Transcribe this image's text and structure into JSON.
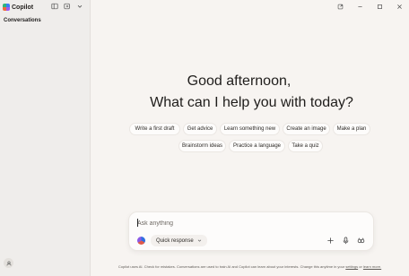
{
  "app": {
    "name": "Copilot"
  },
  "sidebar": {
    "section_title": "Conversations"
  },
  "greeting": {
    "line1": "Good afternoon,",
    "line2": "What can I help you with today?"
  },
  "suggestions": {
    "row1": [
      "Write a first draft",
      "Get advice",
      "Learn something new",
      "Create an image",
      "Make a plan"
    ],
    "row2": [
      "Brainstorm ideas",
      "Practice a language",
      "Take a quiz"
    ]
  },
  "composer": {
    "placeholder": "Ask anything",
    "mode_label": "Quick response"
  },
  "footer": {
    "text": "Copilot uses AI. Check for mistakes. Conversations are used to train AI and Copilot can learn about your interests. Change this anytime in your",
    "settings_link": "settings",
    "or": "or",
    "learn_more_link": "learn more."
  },
  "colors": {
    "background": "#f7f4f1",
    "sidebar": "#efedeb",
    "chip": "#fdfcfb"
  },
  "icons": [
    "copilot-logo-icon",
    "sidebar-toggle-icon",
    "new-chat-icon",
    "chevron-down-icon",
    "open-window-icon",
    "minimize-icon",
    "maximize-icon",
    "close-icon",
    "account-icon",
    "plus-icon",
    "microphone-icon",
    "voice-icon"
  ]
}
